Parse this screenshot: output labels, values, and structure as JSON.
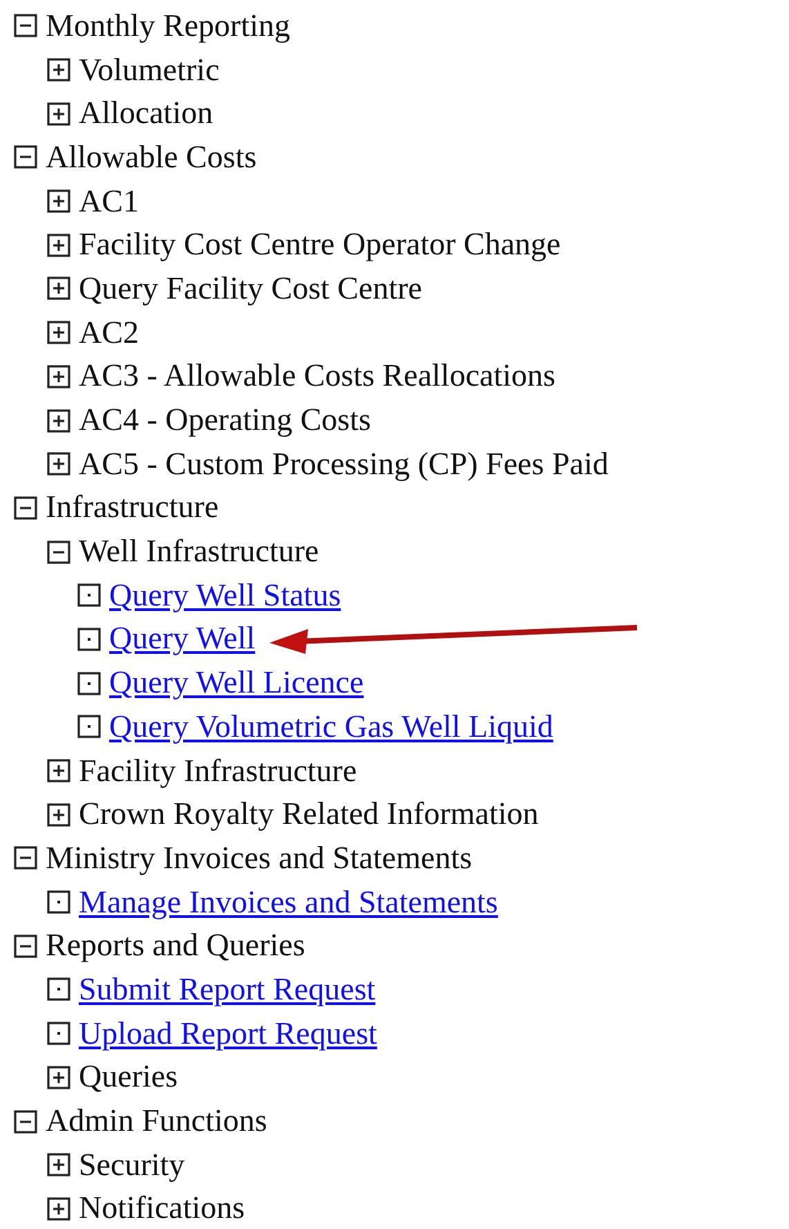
{
  "tree": [
    {
      "kind": "folder",
      "label": "Monthly Reporting",
      "expanded": true,
      "children": [
        {
          "kind": "folder",
          "label": "Volumetric",
          "expanded": false
        },
        {
          "kind": "folder",
          "label": "Allocation",
          "expanded": false
        }
      ]
    },
    {
      "kind": "folder",
      "label": "Allowable Costs",
      "expanded": true,
      "children": [
        {
          "kind": "folder",
          "label": "AC1",
          "expanded": false
        },
        {
          "kind": "folder",
          "label": "Facility Cost Centre Operator Change",
          "expanded": false
        },
        {
          "kind": "folder",
          "label": "Query Facility Cost Centre",
          "expanded": false
        },
        {
          "kind": "folder",
          "label": "AC2",
          "expanded": false
        },
        {
          "kind": "folder",
          "label": "AC3 - Allowable Costs Reallocations",
          "expanded": false
        },
        {
          "kind": "folder",
          "label": "AC4 - Operating Costs",
          "expanded": false
        },
        {
          "kind": "folder",
          "label": "AC5 - Custom Processing (CP) Fees Paid",
          "expanded": false
        }
      ]
    },
    {
      "kind": "folder",
      "label": "Infrastructure",
      "expanded": true,
      "children": [
        {
          "kind": "folder",
          "label": "Well Infrastructure",
          "expanded": true,
          "children": [
            {
              "kind": "link",
              "label": "Query Well Status",
              "arrow": false
            },
            {
              "kind": "link",
              "label": "Query Well",
              "arrow": true
            },
            {
              "kind": "link",
              "label": "Query Well Licence",
              "arrow": false
            },
            {
              "kind": "link",
              "label": "Query Volumetric Gas Well Liquid",
              "arrow": false
            }
          ]
        },
        {
          "kind": "folder",
          "label": "Facility Infrastructure",
          "expanded": false
        },
        {
          "kind": "folder",
          "label": "Crown Royalty Related Information",
          "expanded": false
        }
      ]
    },
    {
      "kind": "folder",
      "label": "Ministry Invoices and Statements",
      "expanded": true,
      "children": [
        {
          "kind": "link",
          "label": "Manage Invoices and Statements",
          "arrow": false
        }
      ]
    },
    {
      "kind": "folder",
      "label": "Reports and Queries",
      "expanded": true,
      "children": [
        {
          "kind": "link",
          "label": "Submit Report Request",
          "arrow": false
        },
        {
          "kind": "link",
          "label": "Upload Report Request",
          "arrow": false
        },
        {
          "kind": "folder",
          "label": "Queries",
          "expanded": false
        }
      ]
    },
    {
      "kind": "folder",
      "label": "Admin Functions",
      "expanded": true,
      "children": [
        {
          "kind": "folder",
          "label": "Security",
          "expanded": false
        },
        {
          "kind": "folder",
          "label": "Notifications",
          "expanded": false
        }
      ]
    }
  ]
}
